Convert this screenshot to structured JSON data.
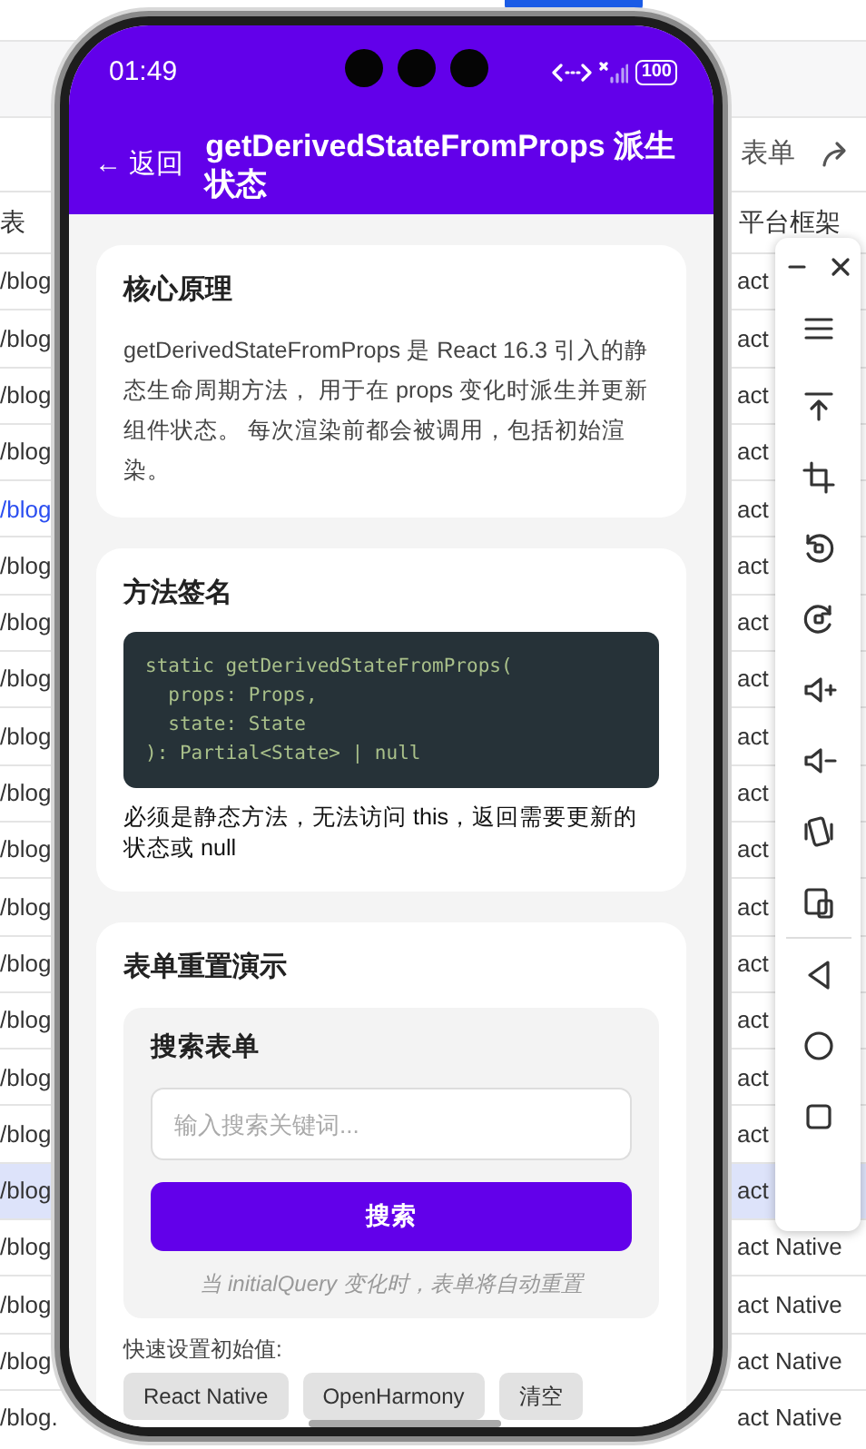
{
  "sheet": {
    "top_action": "表单",
    "headers": [
      "表",
      "平台框架"
    ],
    "rows": [
      {
        "column_1": "/blog",
        "column_2": "act",
        "link": false,
        "selected": false
      },
      {
        "column_1": "/blog",
        "column_2": "act",
        "link": false,
        "selected": false
      },
      {
        "column_1": "/blog",
        "column_2": "act",
        "link": false,
        "selected": false
      },
      {
        "column_1": "/blog",
        "column_2": "act",
        "link": false,
        "selected": false
      },
      {
        "column_1": "/blog",
        "column_2": "act",
        "link": true,
        "selected": false
      },
      {
        "column_1": "/blog",
        "column_2": "act",
        "link": false,
        "selected": false
      },
      {
        "column_1": "/blog",
        "column_2": "act",
        "link": false,
        "selected": false
      },
      {
        "column_1": "/blog",
        "column_2": "act",
        "link": false,
        "selected": false
      },
      {
        "column_1": "/blog",
        "column_2": "act",
        "link": false,
        "selected": false
      },
      {
        "column_1": "/blog",
        "column_2": "act",
        "link": false,
        "selected": false
      },
      {
        "column_1": "/blog",
        "column_2": "act",
        "link": false,
        "selected": false
      },
      {
        "column_1": "/blog",
        "column_2": "act",
        "link": false,
        "selected": false
      },
      {
        "column_1": "/blog",
        "column_2": "act",
        "link": false,
        "selected": false
      },
      {
        "column_1": "/blog",
        "column_2": "act",
        "link": false,
        "selected": false
      },
      {
        "column_1": "/blog",
        "column_2": "act",
        "link": false,
        "selected": false
      },
      {
        "column_1": "/blog",
        "column_2": "act",
        "link": false,
        "selected": false
      },
      {
        "column_1": "/blog",
        "column_2": "act",
        "link": false,
        "selected": true
      },
      {
        "column_1": "/blog",
        "column_2": "act Native",
        "link": false,
        "selected": false
      },
      {
        "column_1": "/blog",
        "column_2": "act Native",
        "link": false,
        "selected": false
      },
      {
        "column_1": "/blog",
        "column_2": "act Native",
        "link": false,
        "selected": false
      },
      {
        "column_1": "/blog.",
        "column_2": "act Native",
        "link": false,
        "selected": false
      }
    ]
  },
  "phone": {
    "status_bar": {
      "time": "01:49",
      "battery": "100"
    },
    "header": {
      "back": "← 返回",
      "title": "getDerivedStateFromProps 派生状态"
    },
    "principle": {
      "title": "核心原理",
      "body": "getDerivedStateFromProps 是 React 16.3 引入的静态生命周期方法， 用于在 props 变化时派生并更新组件状态。 每次渲染前都会被调用，包括初始渲染。"
    },
    "signature": {
      "title": "方法签名",
      "code": [
        "static getDerivedStateFromProps(",
        "  props: Props,",
        "  state: State",
        "): Partial<State> | null"
      ],
      "note": "必须是静态方法，无法访问 this，返回需要更新的状态或 null"
    },
    "demo": {
      "title": "表单重置演示",
      "form": {
        "title": "搜索表单",
        "placeholder": "输入搜索关键词...",
        "button": "搜索",
        "hint": "当 initialQuery 变化时，表单将自动重置"
      },
      "presets_label": "快速设置初始值:",
      "presets": [
        "React Native",
        "OpenHarmony",
        "清空"
      ]
    }
  }
}
